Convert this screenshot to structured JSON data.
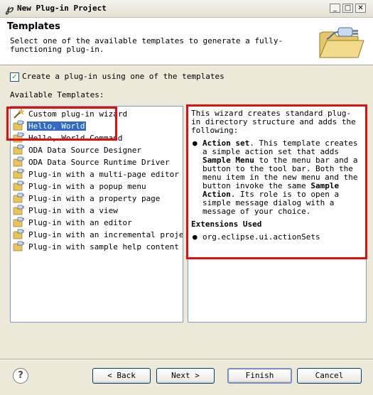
{
  "window": {
    "title": "New Plug-in Project",
    "title_icon": "eclipse-plugin-icon",
    "controls": [
      "minimize-icon",
      "maximize-icon",
      "close-icon"
    ]
  },
  "header": {
    "title": "Templates",
    "description": "Select one of the available templates to generate a fully-functioning plug-in."
  },
  "checkbox": {
    "label": "Create a plug-in using one of the templates",
    "checked": true
  },
  "available_label": "Available Templates:",
  "templates": [
    {
      "label": "Custom plug-in wizard",
      "icon": "wand-icon"
    },
    {
      "label": "Hello, World",
      "icon": "plugin-icon",
      "selected": true
    },
    {
      "label": "Hello, World Command",
      "icon": "plugin-icon"
    },
    {
      "label": "ODA Data Source Designer",
      "icon": "plugin-icon"
    },
    {
      "label": "ODA Data Source Runtime Driver",
      "icon": "plugin-icon"
    },
    {
      "label": "Plug-in with a multi-page editor",
      "icon": "plugin-icon"
    },
    {
      "label": "Plug-in with a popup menu",
      "icon": "plugin-icon"
    },
    {
      "label": "Plug-in with a property page",
      "icon": "plugin-icon"
    },
    {
      "label": "Plug-in with a view",
      "icon": "plugin-icon"
    },
    {
      "label": "Plug-in with an editor",
      "icon": "plugin-icon"
    },
    {
      "label": "Plug-in with an incremental project b",
      "icon": "plugin-icon"
    },
    {
      "label": "Plug-in with sample help content",
      "icon": "plugin-icon"
    }
  ],
  "description_panel": {
    "intro": "This wizard creates standard plug-in directory structure and adds the following:",
    "bullet": {
      "bold_head": "Action set",
      "t1": ". This template creates a simple action set that adds ",
      "bold_mid": "Sample Menu",
      "t2": " to the menu bar and a button to the tool bar. Both the menu item in the new menu and the button invoke the same ",
      "bold_tail": "Sample Action",
      "t3": ". Its role is to open a simple message dialog with a message of your choice."
    },
    "extensions_heading": "Extensions Used",
    "extension": "org.eclipse.ui.actionSets"
  },
  "buttons": {
    "help": "?",
    "back": "< Back",
    "next": "Next >",
    "finish": "Finish",
    "cancel": "Cancel"
  },
  "colors": {
    "selection": "#316ac5",
    "highlight_box": "#e01010",
    "dialog_bg": "#ece9d8"
  }
}
